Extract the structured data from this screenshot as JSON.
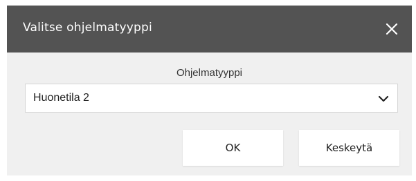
{
  "dialog": {
    "title": "Valitse ohjelmatyyppi",
    "close_icon": "close-icon",
    "field_label": "Ohjelmatyyppi",
    "select": {
      "value": "Huonetila 2",
      "icon": "chevron-down-icon"
    },
    "buttons": {
      "ok_label": "OK",
      "cancel_label": "Keskeytä"
    },
    "colors": {
      "header_bg": "#535353",
      "body_bg": "#f0f0f0",
      "title_text": "#ffffff"
    }
  }
}
